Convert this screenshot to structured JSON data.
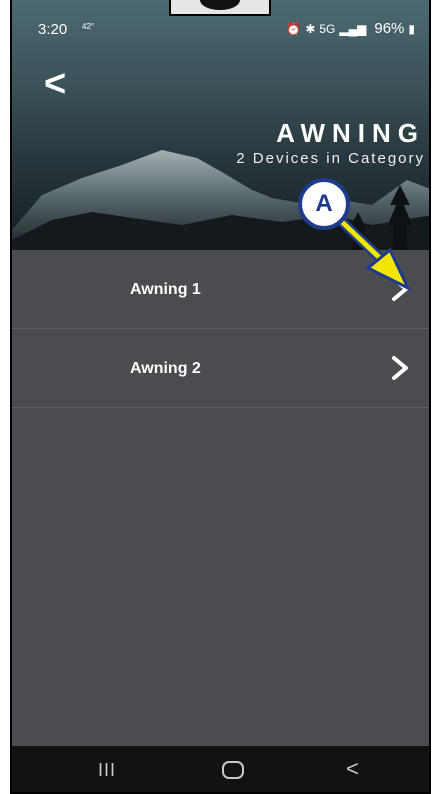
{
  "status_bar": {
    "time": "3:20",
    "temperature": "42°",
    "icons_text": "5G",
    "battery": "96%"
  },
  "header": {
    "back_icon": "<",
    "title": "AWNING",
    "subtitle": "2 Devices in Category"
  },
  "devices": [
    {
      "label": "Awning 1"
    },
    {
      "label": "Awning 2"
    }
  ],
  "annotation": {
    "label": "A"
  },
  "navbar": {
    "recent": "III",
    "back": "<"
  },
  "colors": {
    "background": "#4a4c50",
    "callout_blue": "#1f3b8c",
    "arrow_yellow": "#f2e600"
  }
}
